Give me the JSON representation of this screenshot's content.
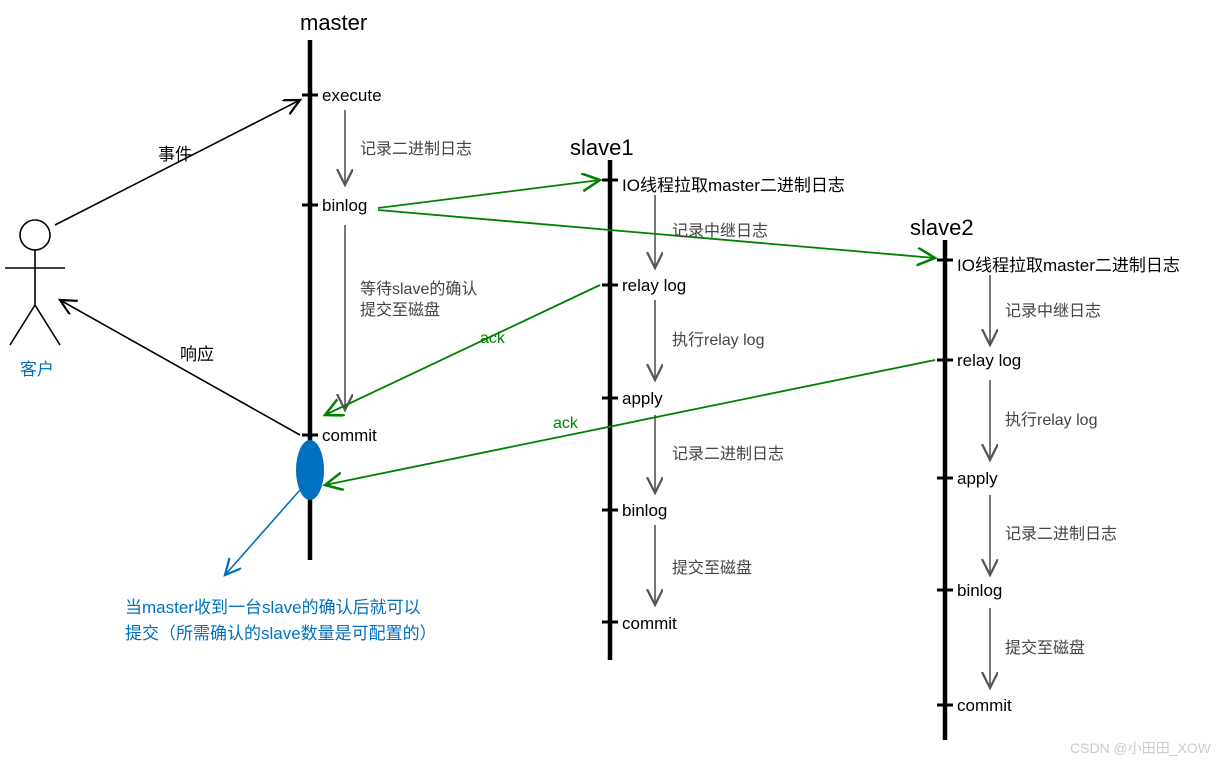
{
  "actor": {
    "label": "客户"
  },
  "master": {
    "title": "master",
    "steps": {
      "execute": "execute",
      "binlog": "binlog",
      "commit": "commit"
    },
    "arrows": {
      "rec_bin": "记录二进制日志",
      "wait1": "等待slave的确认",
      "wait2": "提交至磁盘"
    }
  },
  "slave1": {
    "title": "slave1",
    "steps": {
      "io": "IO线程拉取master二进制日志",
      "relay": "relay log",
      "apply": "apply",
      "binlog": "binlog",
      "commit": "commit"
    },
    "arrows": {
      "rec_relay": "记录中继日志",
      "exec_relay": "执行relay log",
      "rec_bin": "记录二进制日志",
      "to_disk": "提交至磁盘"
    }
  },
  "slave2": {
    "title": "slave2",
    "steps": {
      "io": "IO线程拉取master二进制日志",
      "relay": "relay log",
      "apply": "apply",
      "binlog": "binlog",
      "commit": "commit"
    },
    "arrows": {
      "rec_relay": "记录中继日志",
      "exec_relay": "执行relay log",
      "rec_bin": "记录二进制日志",
      "to_disk": "提交至磁盘"
    }
  },
  "between": {
    "event": "事件",
    "response": "响应",
    "ack": "ack"
  },
  "note": {
    "l1": "当master收到一台slave的确认后就可以",
    "l2": "提交（所需确认的slave数量是可配置的）"
  },
  "watermark": "CSDN @小田田_XOW"
}
